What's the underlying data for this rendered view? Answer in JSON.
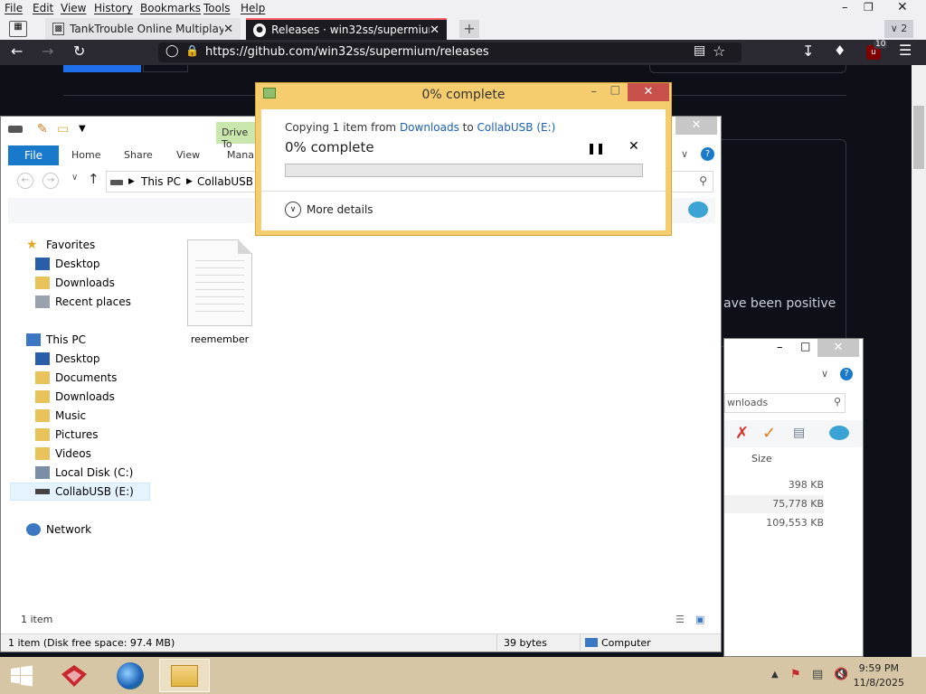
{
  "browser": {
    "menu": [
      "File",
      "Edit",
      "View",
      "History",
      "Bookmarks",
      "Tools",
      "Help"
    ],
    "tabs": [
      {
        "label": "TankTrouble Online Multiplayer"
      },
      {
        "label": "Releases · win32ss/supermium"
      }
    ],
    "url": "https://github.com/win32ss/supermium/releases",
    "tab_count_badge": "2",
    "extension_badge": "10",
    "page_fragment": "ave been positive"
  },
  "explorer": {
    "context_tab": "Drive To",
    "ribbon_tabs": [
      "File",
      "Home",
      "Share",
      "View",
      "Mana"
    ],
    "breadcrumb": [
      "This PC",
      "CollabUSB ("
    ],
    "nav": [
      {
        "label": "Favorites",
        "icon": "star-icon"
      },
      {
        "label": "Desktop",
        "icon": "desktop-icon"
      },
      {
        "label": "Downloads",
        "icon": "downloads-icon"
      },
      {
        "label": "Recent places",
        "icon": "recent-places-icon"
      },
      {
        "label": "This PC",
        "icon": "computer-icon"
      },
      {
        "label": "Desktop",
        "icon": "desktop-icon"
      },
      {
        "label": "Documents",
        "icon": "folder-icon"
      },
      {
        "label": "Downloads",
        "icon": "folder-icon"
      },
      {
        "label": "Music",
        "icon": "folder-icon"
      },
      {
        "label": "Pictures",
        "icon": "folder-icon"
      },
      {
        "label": "Videos",
        "icon": "folder-icon"
      },
      {
        "label": "Local Disk (C:)",
        "icon": "local-disk-icon"
      },
      {
        "label": "CollabUSB (E:)",
        "icon": "usb-drive-icon"
      },
      {
        "label": "Network",
        "icon": "network-icon"
      }
    ],
    "file_name": "reemember",
    "item_count": "1 item",
    "status": {
      "selection": "1 item (Disk free space: 97.4 MB)",
      "size": "39 bytes",
      "location": "Computer"
    }
  },
  "explorer2": {
    "search_text": "wnloads",
    "column_header": "Size",
    "sizes": [
      "398 KB",
      "75,778 KB",
      "109,553 KB"
    ]
  },
  "copy_dialog": {
    "title": "0% complete",
    "copying_prefix": "Copying 1 item from ",
    "source": "Downloads",
    "to": " to ",
    "destination": "CollabUSB (E:)",
    "percent_text": "0% complete",
    "progress": 0,
    "more_details": "More details"
  },
  "taskbar": {
    "time": "9:59 PM",
    "date": "11/8/2025"
  },
  "colors": {
    "dialog_frame": "#f6cd6e",
    "file_tab": "#1979ca",
    "taskbar": "#d7c6a6",
    "close_button": "#c7504b"
  }
}
